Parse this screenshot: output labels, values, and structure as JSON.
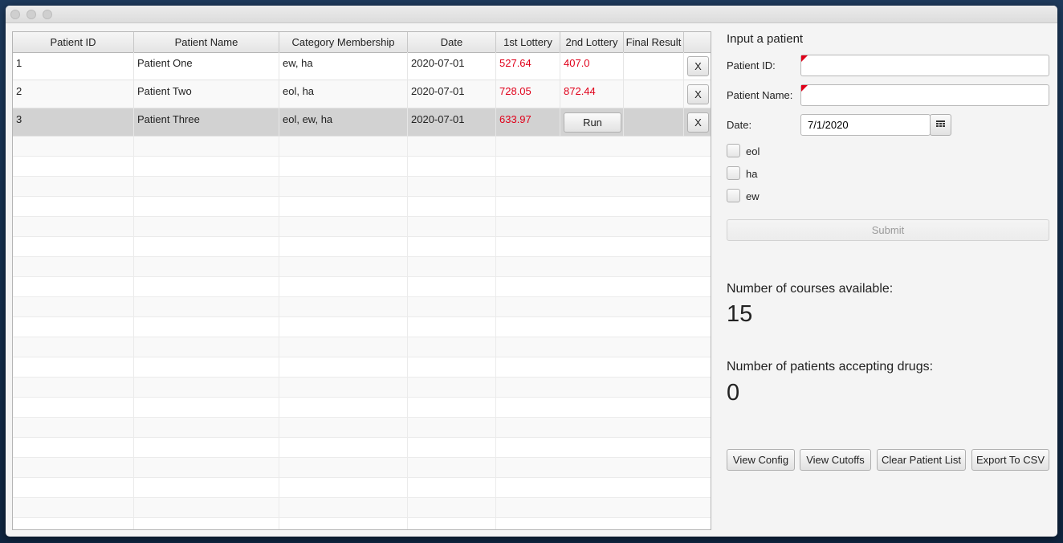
{
  "table": {
    "columns": [
      "Patient ID",
      "Patient Name",
      "Category Membership",
      "Date",
      "1st Lottery",
      "2nd Lottery",
      "Final Result",
      ""
    ],
    "rows": [
      {
        "id": "1",
        "name": "Patient One",
        "category": "ew, ha",
        "date": "2020-07-01",
        "lottery1": "527.64",
        "lottery2": "407.0",
        "final": "",
        "delete": "X"
      },
      {
        "id": "2",
        "name": "Patient Two",
        "category": "eol, ha",
        "date": "2020-07-01",
        "lottery1": "728.05",
        "lottery2": "872.44",
        "final": "",
        "delete": "X"
      },
      {
        "id": "3",
        "name": "Patient Three",
        "category": "eol, ew, ha",
        "date": "2020-07-01",
        "lottery1": "633.97",
        "lottery2_button": "Run",
        "final": "",
        "delete": "X"
      }
    ]
  },
  "form": {
    "title": "Input a patient",
    "patient_id_label": "Patient ID:",
    "patient_id_value": "",
    "patient_name_label": "Patient Name:",
    "patient_name_value": "",
    "date_label": "Date:",
    "date_value": "7/1/2020",
    "checkboxes": [
      {
        "label": "eol",
        "checked": false
      },
      {
        "label": "ha",
        "checked": false
      },
      {
        "label": "ew",
        "checked": false
      }
    ],
    "submit_label": "Submit"
  },
  "stats": {
    "courses_label": "Number of courses available:",
    "courses_value": "15",
    "patients_label": "Number of patients accepting drugs:",
    "patients_value": "0"
  },
  "actions": {
    "view_config": "View Config",
    "view_cutoffs": "View Cutoffs",
    "clear_patient_list": "Clear Patient List",
    "export_csv": "Export To CSV"
  },
  "colors": {
    "lottery_text": "#e0001a",
    "selected_row": "#d2d2d2"
  }
}
